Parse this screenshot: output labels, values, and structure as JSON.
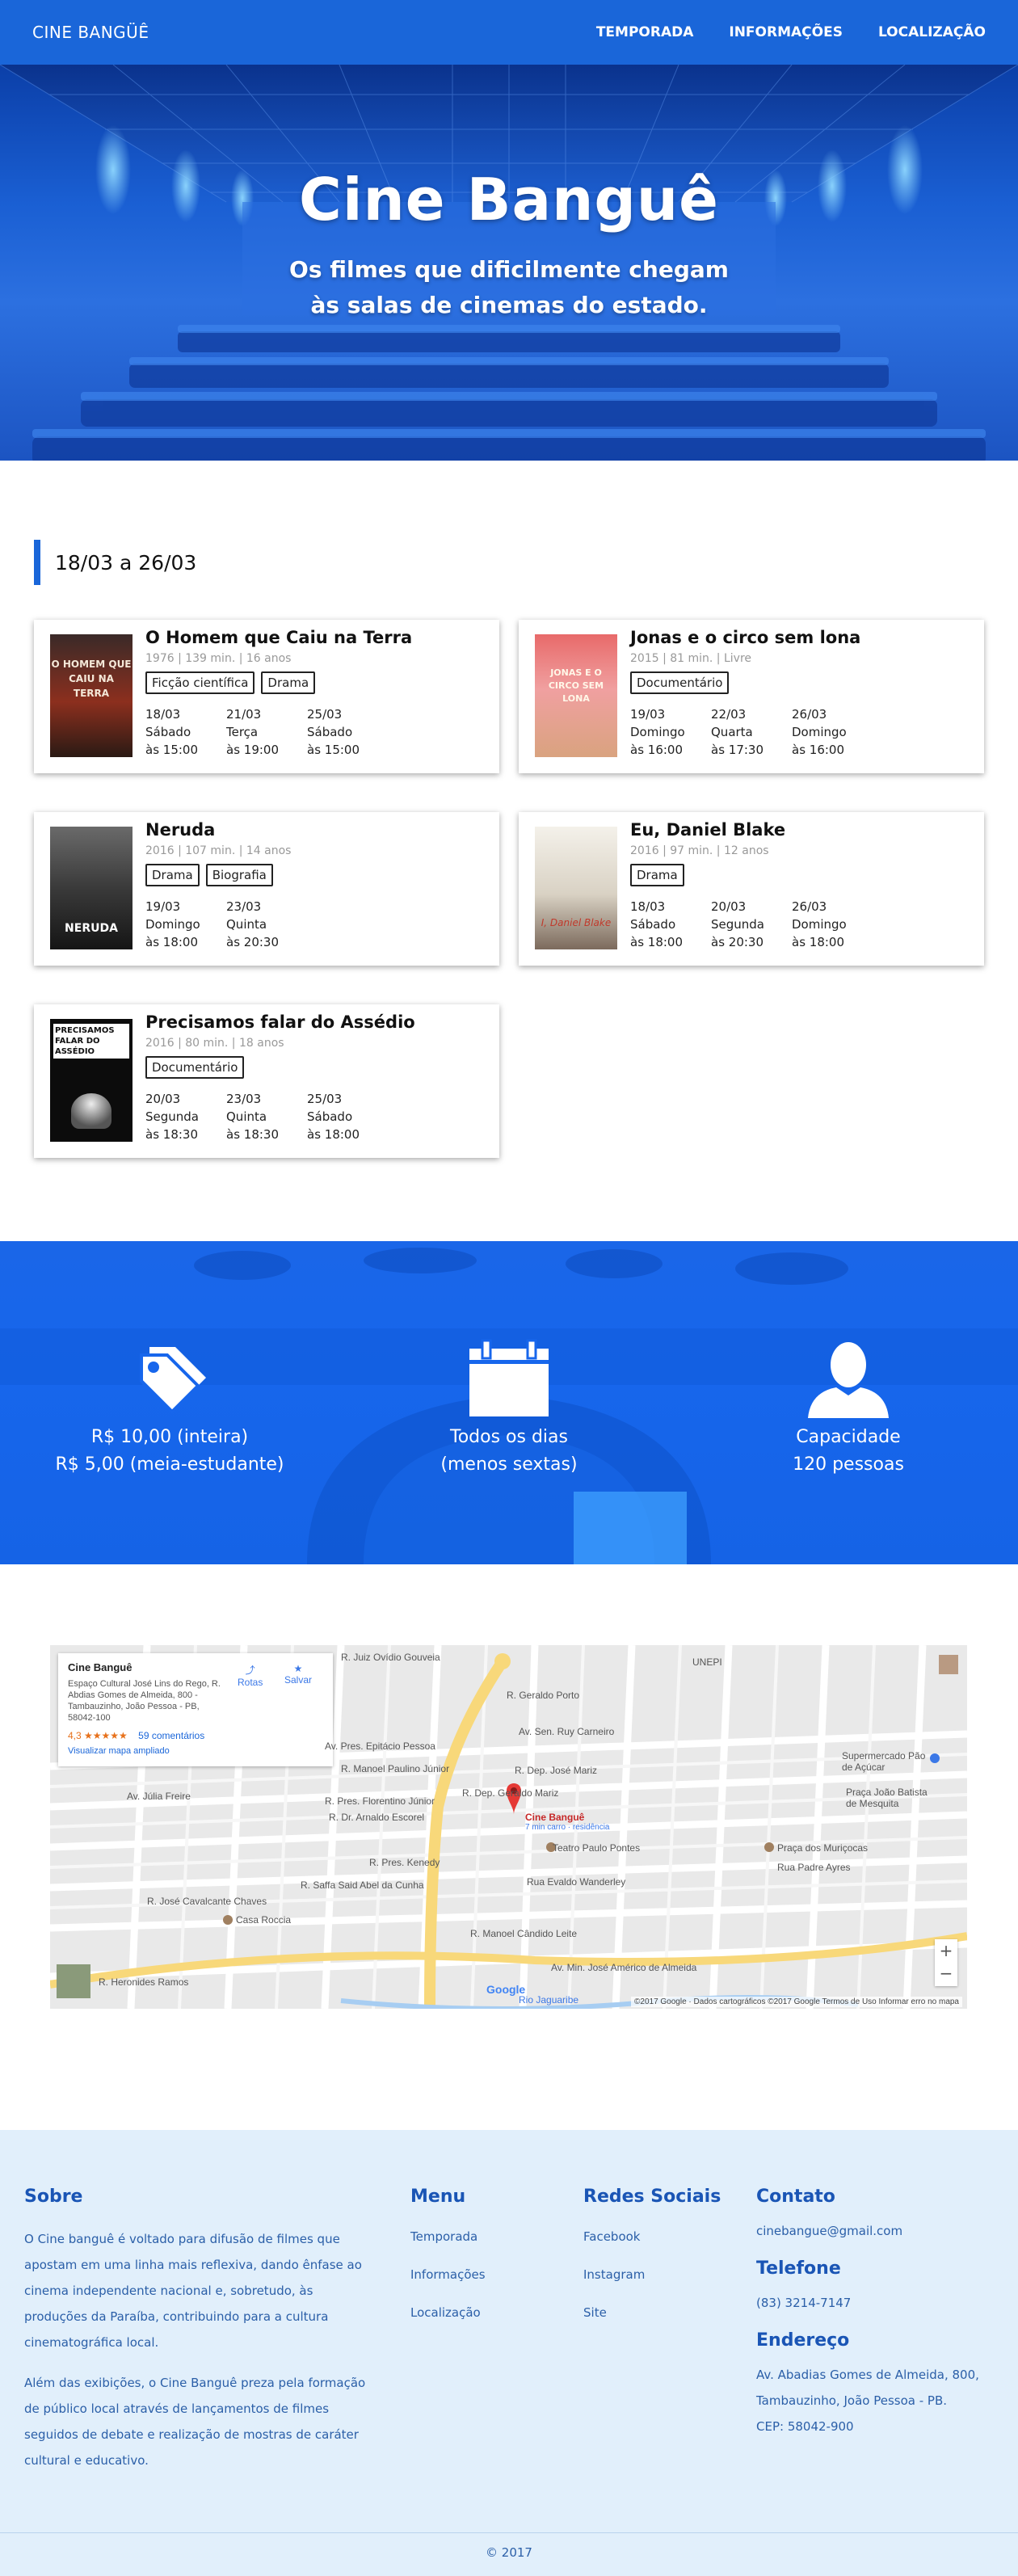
{
  "nav": {
    "brand": "CINE BANGÜÊ",
    "links": [
      "TEMPORADA",
      "INFORMAÇÕES",
      "LOCALIZAÇÃO"
    ]
  },
  "hero": {
    "title": "Cine Banguê",
    "subtitle_1": "Os filmes que dificilmente chegam",
    "subtitle_2": "às salas de cinemas do estado."
  },
  "season": {
    "range": "18/03 a 26/03",
    "films": [
      {
        "title": "O Homem que Caiu na Terra",
        "meta": "1976 | 139 min. | 16 anos",
        "tags": [
          "Ficção científica",
          "Drama"
        ],
        "poster_text": "O HOMEM QUE CAIU NA TERRA",
        "sessions": [
          {
            "date": "18/03",
            "day": "Sábado",
            "time": "às 15:00"
          },
          {
            "date": "21/03",
            "day": "Terça",
            "time": "às 19:00"
          },
          {
            "date": "25/03",
            "day": "Sábado",
            "time": "às 15:00"
          }
        ]
      },
      {
        "title": "Jonas e o circo sem lona",
        "meta": "2015 | 81 min. | Livre",
        "tags": [
          "Documentário"
        ],
        "poster_text": "JONAS E O CIRCO SEM LONA",
        "sessions": [
          {
            "date": "19/03",
            "day": "Domingo",
            "time": "às 16:00"
          },
          {
            "date": "22/03",
            "day": "Quarta",
            "time": "às 17:30"
          },
          {
            "date": "26/03",
            "day": "Domingo",
            "time": "às 16:00"
          }
        ]
      },
      {
        "title": "Neruda",
        "meta": "2016 | 107 min. | 14 anos",
        "tags": [
          "Drama",
          "Biografia"
        ],
        "poster_text": "NERUDA",
        "sessions": [
          {
            "date": "19/03",
            "day": "Domingo",
            "time": "às 18:00"
          },
          {
            "date": "23/03",
            "day": "Quinta",
            "time": "às 20:30"
          }
        ]
      },
      {
        "title": "Eu, Daniel Blake",
        "meta": "2016 | 97 min. | 12 anos",
        "tags": [
          "Drama"
        ],
        "poster_text": "I, Daniel Blake",
        "sessions": [
          {
            "date": "18/03",
            "day": "Sábado",
            "time": "às 18:00"
          },
          {
            "date": "20/03",
            "day": "Segunda",
            "time": "às 20:30"
          },
          {
            "date": "26/03",
            "day": "Domingo",
            "time": "às 18:00"
          }
        ]
      },
      {
        "title": "Precisamos falar do Assédio",
        "meta": "2016 | 80 min. | 18 anos",
        "tags": [
          "Documentário"
        ],
        "poster_text": "PRECISAMOS FALAR DO ASSÉDIO",
        "sessions": [
          {
            "date": "20/03",
            "day": "Segunda",
            "time": "às 18:30"
          },
          {
            "date": "23/03",
            "day": "Quinta",
            "time": "às 18:30"
          },
          {
            "date": "25/03",
            "day": "Sábado",
            "time": "às 18:00"
          }
        ]
      }
    ]
  },
  "info": {
    "price": {
      "icon": "price-tags-icon",
      "line1": "R$ 10,00 (inteira)",
      "line2": "R$ 5,00 (meia-estudante)"
    },
    "days": {
      "icon": "calendar-icon",
      "line1": "Todos os dias",
      "line2": "(menos sextas)"
    },
    "capacity": {
      "icon": "person-icon",
      "line1": "Capacidade",
      "line2": "120 pessoas"
    }
  },
  "map": {
    "place_name": "Cine Banguê",
    "address": "Espaço Cultural José Lins do Rego, R. Abdias Gomes de Almeida, 800 - Tambauzinho, João Pessoa - PB, 58042-100",
    "rating": "4,3 ★★★★★",
    "reviews": "59 comentários",
    "larger_map": "Visualizar mapa ampliado",
    "directions": "Rotas",
    "save": "Salvar",
    "marker_label": "Cine Banguê",
    "marker_sub": "7 min carro · residência",
    "labels": [
      "R. Juiz Ovídio Gouveia",
      "R. Geraldo Porto",
      "Av. Sen. Ruy Carneiro",
      "UNEPI",
      "Av. Pres. Epitácio Pessoa",
      "R. Manoel Paulino Júnior",
      "R. Pres. Florentino Júnior",
      "R. Dep. José Mariz",
      "R. Dep. Geraldo Mariz",
      "R. Dr. Arnaldo Escorel",
      "Teatro Paulo Pontes",
      "R. Pres. Kenedy",
      "R. Saffa Said Abel da Cunha",
      "Rua Evaldo Wanderley",
      "Casa Roccia",
      "R. Manoel Cândido Leite",
      "Av. Min. José Américo de Almeida",
      "R. Heronides Ramos",
      "Supermercado Pão de Açúcar",
      "Praça João Batista de Mesquita",
      "Praça dos Muriçocas",
      "Rua Padre Ayres",
      "Rio Jaguaribe",
      "Av. Júlia Freire",
      "R. José Cavalcante Chaves"
    ],
    "attribution": "©2017 Google · Dados cartográficos ©2017 Google   Termos de Uso   Informar erro no mapa",
    "google": "Google",
    "zoom_in": "+",
    "zoom_out": "−"
  },
  "footer": {
    "about_title": "Sobre",
    "about_p1": "O Cine banguê é voltado para difusão de filmes que apostam em uma linha mais reflexiva, dando ênfase ao cinema independente nacional e, sobretudo, às produções da Paraíba, contribuindo para a cultura cinematográfica local.",
    "about_p2": "Além das exibições, o Cine Banguê preza pela formação de público local através de lançamentos de filmes seguidos de debate e realização de mostras de caráter cultural e educativo.",
    "menu_title": "Menu",
    "menu_links": [
      "Temporada",
      "Informações",
      "Localização"
    ],
    "social_title": "Redes Sociais",
    "social_links": [
      "Facebook",
      "Instagram",
      "Site"
    ],
    "contact_title": "Contato",
    "email": "cinebangue@gmail.com",
    "phone_title": "Telefone",
    "phone": "(83) 3214-7147",
    "address_title": "Endereço",
    "address_1": "Av. Abadias Gomes de Almeida, 800,",
    "address_2": "Tambauzinho, João Pessoa - PB.",
    "address_3": "CEP: 58042-900",
    "copyright": "© 2017"
  }
}
